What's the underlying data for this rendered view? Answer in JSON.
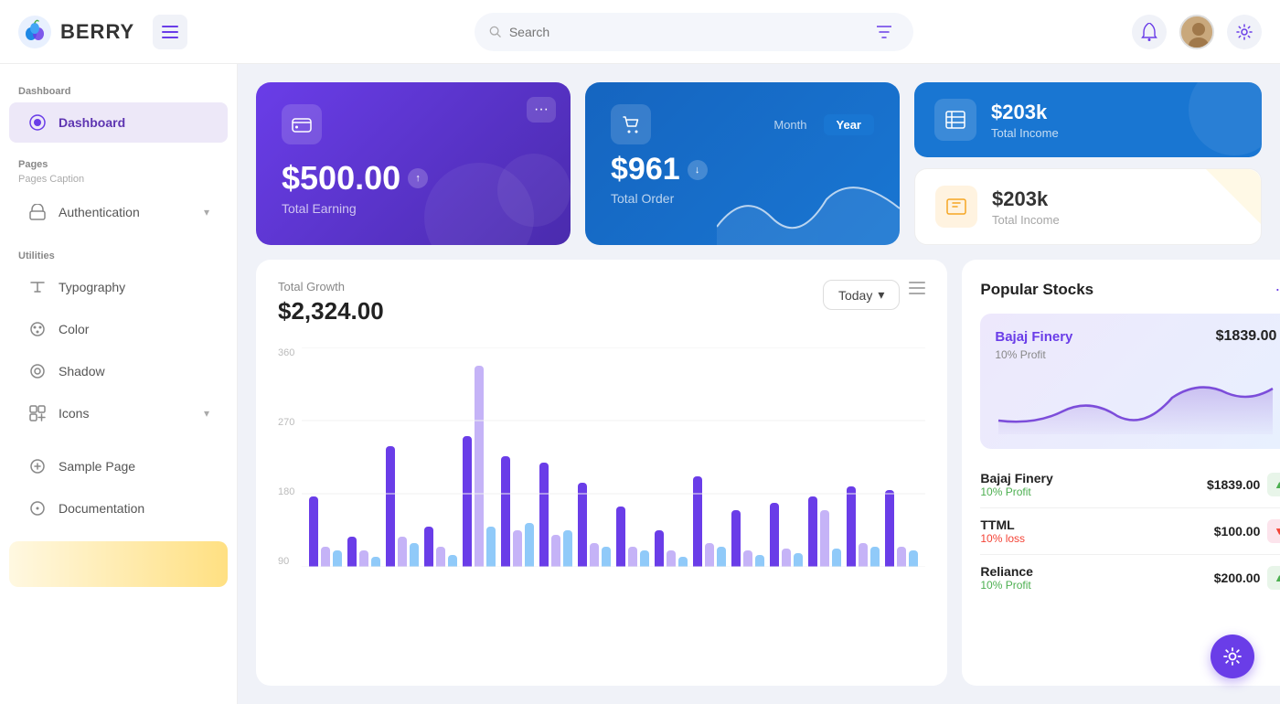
{
  "app": {
    "name": "BERRY"
  },
  "topbar": {
    "search_placeholder": "Search",
    "hamburger_label": "Toggle menu"
  },
  "sidebar": {
    "sections": [
      {
        "label": "Dashboard",
        "items": [
          {
            "id": "dashboard",
            "label": "Dashboard",
            "icon": "dashboard-icon",
            "active": true
          }
        ]
      },
      {
        "label": "Pages",
        "caption": "Pages Caption",
        "items": [
          {
            "id": "authentication",
            "label": "Authentication",
            "icon": "auth-icon",
            "hasChevron": true
          }
        ]
      },
      {
        "label": "Utilities",
        "items": [
          {
            "id": "typography",
            "label": "Typography",
            "icon": "type-icon"
          },
          {
            "id": "color",
            "label": "Color",
            "icon": "color-icon"
          },
          {
            "id": "shadow",
            "label": "Shadow",
            "icon": "shadow-icon"
          },
          {
            "id": "icons",
            "label": "Icons",
            "icon": "icons-icon",
            "hasChevron": true
          }
        ]
      },
      {
        "label": "",
        "items": [
          {
            "id": "sample-page",
            "label": "Sample Page",
            "icon": "sample-icon"
          },
          {
            "id": "documentation",
            "label": "Documentation",
            "icon": "docs-icon"
          }
        ]
      }
    ]
  },
  "cards": {
    "earning": {
      "amount": "$500.00",
      "label": "Total Earning"
    },
    "order": {
      "amount": "$961",
      "label": "Total Order",
      "tabs": [
        "Month",
        "Year"
      ],
      "active_tab": "Year"
    },
    "total_income_1": {
      "amount": "$203k",
      "label": "Total Income"
    },
    "total_income_2": {
      "amount": "$203k",
      "label": "Total Income"
    }
  },
  "chart": {
    "title": "Total Growth",
    "amount": "$2,324.00",
    "filter": "Today",
    "y_labels": [
      "360",
      "270",
      "180",
      "90"
    ],
    "bars": [
      {
        "p": 35,
        "lp": 10,
        "lb": 8
      },
      {
        "p": 15,
        "lp": 8,
        "lb": 5
      },
      {
        "p": 60,
        "lp": 15,
        "lb": 12
      },
      {
        "p": 20,
        "lp": 10,
        "lb": 6
      },
      {
        "p": 65,
        "lp": 100,
        "lb": 20
      },
      {
        "p": 55,
        "lp": 18,
        "lb": 22
      },
      {
        "p": 52,
        "lp": 16,
        "lb": 18
      },
      {
        "p": 42,
        "lp": 12,
        "lb": 10
      },
      {
        "p": 30,
        "lp": 10,
        "lb": 8
      },
      {
        "p": 18,
        "lp": 8,
        "lb": 5
      },
      {
        "p": 45,
        "lp": 12,
        "lb": 10
      },
      {
        "p": 28,
        "lp": 8,
        "lb": 6
      },
      {
        "p": 32,
        "lp": 9,
        "lb": 7
      },
      {
        "p": 35,
        "lp": 28,
        "lb": 9
      },
      {
        "p": 40,
        "lp": 12,
        "lb": 10
      },
      {
        "p": 38,
        "lp": 10,
        "lb": 8
      }
    ]
  },
  "stocks": {
    "title": "Popular Stocks",
    "featured": {
      "name": "Bajaj Finery",
      "price": "$1839.00",
      "profit_label": "10% Profit"
    },
    "list": [
      {
        "name": "Bajaj Finery",
        "profit": "10% Profit",
        "profit_type": "green",
        "price": "$1839.00",
        "trend": "up"
      },
      {
        "name": "TTML",
        "profit": "10% loss",
        "profit_type": "red",
        "price": "$100.00",
        "trend": "down"
      },
      {
        "name": "Reliance",
        "profit": "10% Profit",
        "profit_type": "green",
        "price": "$200.00",
        "trend": "up"
      }
    ]
  }
}
